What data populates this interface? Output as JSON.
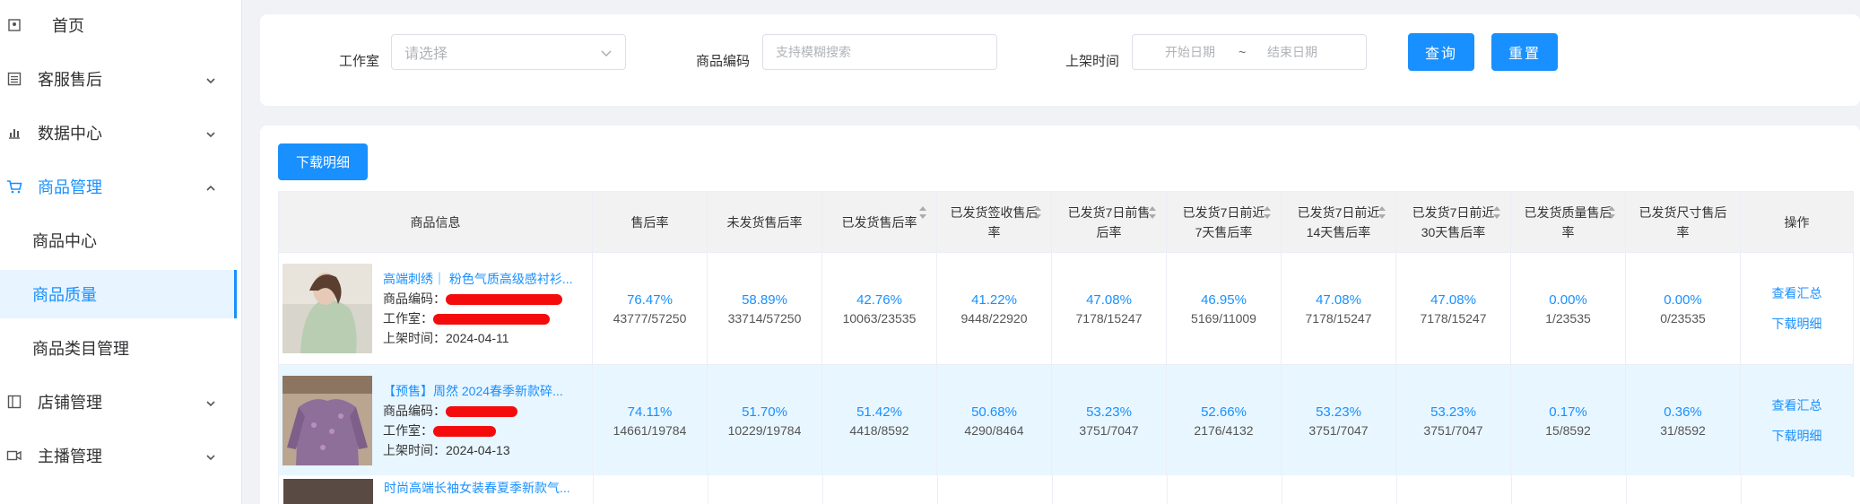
{
  "sidebar": {
    "items": [
      {
        "label": "首页",
        "icon": "home-icon"
      },
      {
        "label": "客服售后",
        "icon": "list-icon"
      },
      {
        "label": "数据中心",
        "icon": "chart-icon"
      },
      {
        "label": "商品管理",
        "icon": "cart-icon"
      },
      {
        "label": "店铺管理",
        "icon": "shop-icon"
      },
      {
        "label": "主播管理",
        "icon": "video-icon"
      }
    ],
    "sub_items": [
      {
        "label": "商品中心"
      },
      {
        "label": "商品质量"
      },
      {
        "label": "商品类目管理"
      }
    ]
  },
  "filters": {
    "studio_label": "工作室",
    "studio_placeholder": "请选择",
    "code_label": "商品编码",
    "code_placeholder": "支持模糊搜索",
    "time_label": "上架时间",
    "start_placeholder": "开始日期",
    "range_sep": "~",
    "end_placeholder": "结束日期",
    "query_label": "查询",
    "reset_label": "重置"
  },
  "table": {
    "download_label": "下载明细",
    "headers": [
      "商品信息",
      "售后率",
      "未发货售后率",
      "已发货售后率",
      "已发货签收售后率",
      "已发货7日前售后率",
      "已发货7日前近7天售后率",
      "已发货7日前近14天售后率",
      "已发货7日前近30天售后率",
      "已发货质量售后率",
      "已发货尺寸售后率",
      "操作"
    ],
    "code_prefix": "商品编码：",
    "studio_prefix": "工作室：",
    "time_prefix": "上架时间：",
    "op_summary": "查看汇总",
    "op_detail": "下载明细",
    "rows": [
      {
        "name": "高端刺绣｜ 粉色气质高级感衬衫...",
        "listed": "2024-04-11",
        "cells": [
          {
            "rate": "76.47%",
            "frac": "43777/57250"
          },
          {
            "rate": "58.89%",
            "frac": "33714/57250"
          },
          {
            "rate": "42.76%",
            "frac": "10063/23535"
          },
          {
            "rate": "41.22%",
            "frac": "9448/22920"
          },
          {
            "rate": "47.08%",
            "frac": "7178/15247"
          },
          {
            "rate": "46.95%",
            "frac": "5169/11009"
          },
          {
            "rate": "47.08%",
            "frac": "7178/15247"
          },
          {
            "rate": "47.08%",
            "frac": "7178/15247"
          },
          {
            "rate": "0.00%",
            "frac": "1/23535"
          },
          {
            "rate": "0.00%",
            "frac": "0/23535"
          }
        ]
      },
      {
        "name": "【预售】周然 2024春季新款碎...",
        "listed": "2024-04-13",
        "cells": [
          {
            "rate": "74.11%",
            "frac": "14661/19784"
          },
          {
            "rate": "51.70%",
            "frac": "10229/19784"
          },
          {
            "rate": "51.42%",
            "frac": "4418/8592"
          },
          {
            "rate": "50.68%",
            "frac": "4290/8464"
          },
          {
            "rate": "53.23%",
            "frac": "3751/7047"
          },
          {
            "rate": "52.66%",
            "frac": "2176/4132"
          },
          {
            "rate": "53.23%",
            "frac": "3751/7047"
          },
          {
            "rate": "53.23%",
            "frac": "3751/7047"
          },
          {
            "rate": "0.17%",
            "frac": "15/8592"
          },
          {
            "rate": "0.36%",
            "frac": "31/8592"
          }
        ]
      }
    ],
    "partial_row_name": "时尚高端长袖女装春夏季新款气..."
  },
  "colors": {
    "primary": "#1890ff",
    "highlight_row": "#e8f6ff",
    "redaction": "#f40c0c"
  }
}
